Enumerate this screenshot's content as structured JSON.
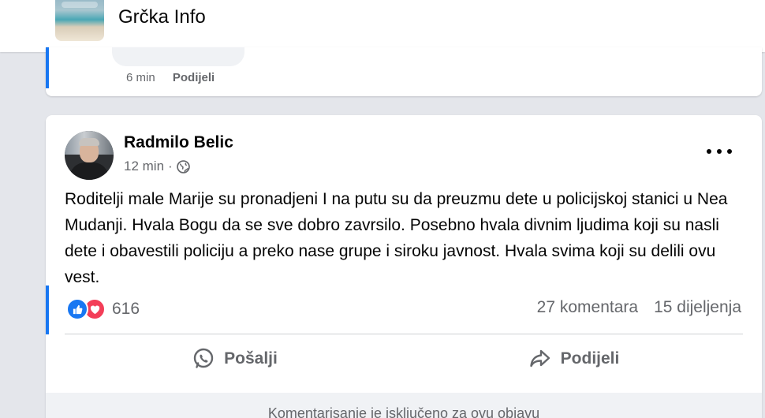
{
  "header": {
    "group_name": "Grčka Info"
  },
  "previous_post": {
    "time": "6 min",
    "share_label": "Podijeli"
  },
  "post": {
    "author": "Radmilo Belic",
    "time": "12 min",
    "separator": "·",
    "text": "Roditelji male Marije su pronadjeni I na putu su da preuzmu dete u policijskoj stanici u Nea Mudanji. Hvala Bogu da se sve dobro zavrsilo. Posebno hvala divnim ljudima koji su nasli dete i obavestili policiju a preko nase grupe i siroku javnost. Hvala svima koji su delili ovu vest.",
    "reactions_count": "616",
    "comments_count": "27 komentara",
    "shares_count": "15 dijeljenja",
    "actions": {
      "send": "Pošalji",
      "share": "Podijeli"
    },
    "comment_notice": "Komentarisanje je isključeno za ovu objavu"
  },
  "colors": {
    "accent": "#1877f2",
    "love": "#f33e58",
    "muted_text": "#65676b",
    "page_bg": "#e4e6eb"
  },
  "icons": [
    "globe-icon",
    "more-icon",
    "like-reaction-icon",
    "love-reaction-icon",
    "messenger-send-icon",
    "share-arrow-icon"
  ]
}
